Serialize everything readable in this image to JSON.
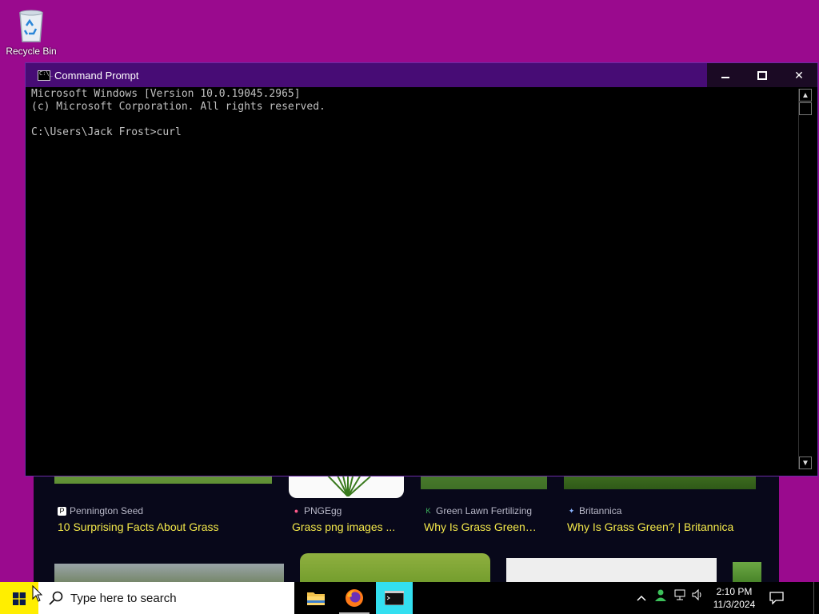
{
  "desktop": {
    "recycle_bin_label": "Recycle Bin"
  },
  "browser_results": [
    {
      "source": "Pennington Seed",
      "title": "10 Surprising Facts About Grass",
      "favicon": "P"
    },
    {
      "source": "PNGEgg",
      "title": "Grass png images ...",
      "favicon": "●"
    },
    {
      "source": "Green Lawn Fertilizing",
      "title": "Why Is Grass Green…",
      "favicon": "K"
    },
    {
      "source": "Britannica",
      "title": "Why Is Grass Green? | Britannica",
      "favicon": "✦"
    }
  ],
  "cmd": {
    "title": "Command Prompt",
    "icon_text": "C:\\_",
    "lines": [
      "Microsoft Windows [Version 10.0.19045.2965]",
      "(c) Microsoft Corporation. All rights reserved.",
      "",
      "C:\\Users\\Jack Frost>curl"
    ]
  },
  "taskbar": {
    "search_placeholder": "Type here to search",
    "time": "2:10 PM",
    "date": "11/3/2024"
  },
  "colors": {
    "desktop_bg": "#9a0a8e",
    "cmd_titlebar": "#470c75",
    "start_button": "#ffee00",
    "active_app": "#33dff0",
    "result_title": "#f4e94a"
  }
}
